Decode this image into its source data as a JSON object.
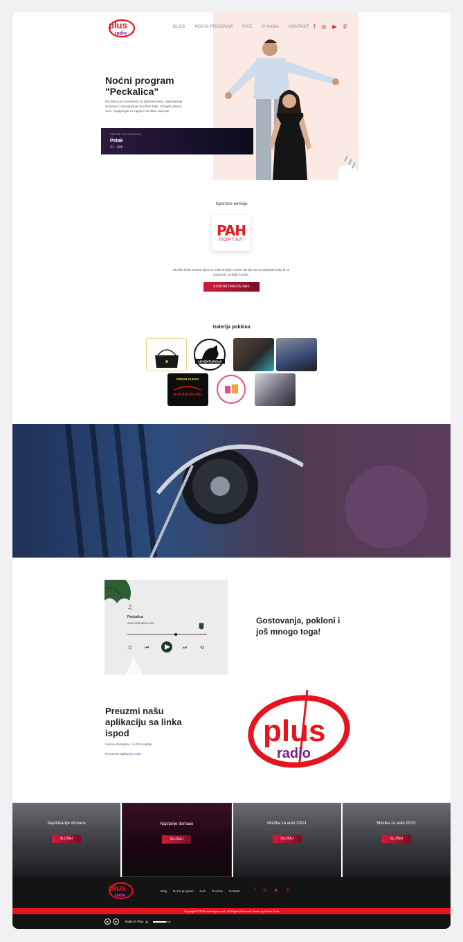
{
  "header": {
    "nav": [
      "BLOG",
      "NOĆNI PROGRAM",
      "KVIZ",
      "O NAMA",
      "KONTAKT"
    ],
    "social_icons": [
      "facebook-icon",
      "instagram-icon",
      "youtube-icon",
      "viber-icon"
    ]
  },
  "logo": {
    "top": "plus",
    "bottom": "radio"
  },
  "hero": {
    "title": "Noćni program \"Peckalica\"",
    "description": "Peckalica je rezervisana za aktuelne teme, odgovaranje slušalaca i ispunjavanje muzičkih želja. Uživajte petkom veče i zapljevajte sa zajedno za dane vikenda!",
    "schedule_label": "VREME EMITOVANJA",
    "schedule_day": "Petak",
    "schedule_time": "21 - 00h"
  },
  "sponsor": {
    "title": "Sponzor emisije",
    "logo_big": "PAH",
    "logo_small": "ПОРТАЛ",
    "text": "Ukoliko želite budete sponzor naše emisije, molim vas da nas kontaktirate kako bi se dogovorili za dalje korake.",
    "button": "KONTAKTIRAJTE NAS"
  },
  "gallery": {
    "title": "Galerija poklona",
    "items": [
      "Gift Bag",
      "Adventurous Horse Riding",
      "Gift 3",
      "Gift 4",
      "Fresh Clean Auto Detailing",
      "Gift 6",
      "Gift 7"
    ]
  },
  "promo": {
    "player_title": "Peckalica",
    "player_url": "www.radioplus.com",
    "heading1": "Gostovanja, pokloni i još mnogo toga!",
    "heading2": "Preuzmi našu aplikaciju sa linka ispod",
    "sub": "Uskoro dostupna i za iOS uređaje",
    "link_prefix": "Preuzmite aplikaciju",
    "link_text": "ovdje"
  },
  "cards": [
    {
      "title": "Najslušanije domaće",
      "button": "SLUŠAJ"
    },
    {
      "title": "Najstarije domaće",
      "button": "SLUŠAJ"
    },
    {
      "title": "Muzika za auto 20/21",
      "button": "SLUŠAJ"
    },
    {
      "title": "Muzika za auto 20/21",
      "button": "SLUŠAJ"
    }
  ],
  "footer": {
    "nav": [
      "Blog",
      "Noćni program",
      "Kviz",
      "O nama",
      "Kontakt"
    ],
    "copyright": "Copyright © 2021 radiodoplus.net | All Rights Reserved. Made by Robot Code",
    "player_name": "Radio D Plus",
    "volume_fraction": 0.75
  },
  "colors": {
    "brand_red": "#e5141f",
    "hero_bg": "#fbe9e4",
    "footer_bg": "#141414"
  }
}
